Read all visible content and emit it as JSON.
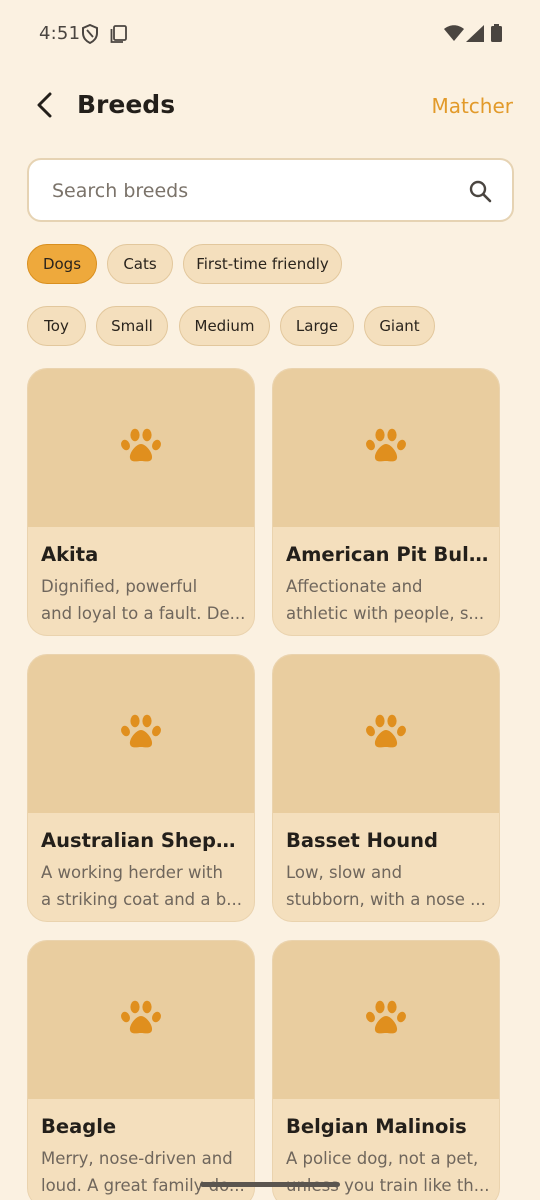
{
  "status_bar": {
    "time": "4:51",
    "icons": [
      "shield-icon",
      "screenshot-icon",
      "wifi-icon",
      "signal-icon",
      "battery-icon"
    ]
  },
  "app_bar": {
    "back_icon": "arrow-back-icon",
    "title": "Breeds",
    "action_label": "Matcher"
  },
  "search": {
    "placeholder": "Search breeds",
    "icon": "search-icon"
  },
  "filters": {
    "species": [
      {
        "label": "Dogs",
        "selected": true
      },
      {
        "label": "Cats",
        "selected": false
      },
      {
        "label": "First-time friendly",
        "selected": false
      }
    ],
    "sizes": [
      {
        "label": "Toy",
        "selected": false
      },
      {
        "label": "Small",
        "selected": false
      },
      {
        "label": "Medium",
        "selected": false
      },
      {
        "label": "Large",
        "selected": false
      },
      {
        "label": "Giant",
        "selected": false
      }
    ]
  },
  "breeds": [
    {
      "name": "Akita",
      "desc_line1": "Dignified, powerful",
      "desc_line2": "and loyal to a fault. De..."
    },
    {
      "name": "American Pit Bull T...",
      "desc_line1": "Affectionate and",
      "desc_line2": "athletic with people, s..."
    },
    {
      "name": "Australian Shepherd",
      "desc_line1": "A working herder with",
      "desc_line2": "a striking coat and a b..."
    },
    {
      "name": "Basset Hound",
      "desc_line1": "Low, slow and",
      "desc_line2": "stubborn, with a nose ..."
    },
    {
      "name": "Beagle",
      "desc_line1": "Merry, nose-driven and",
      "desc_line2": "loud. A great family do..."
    },
    {
      "name": "Belgian Malinois",
      "desc_line1": "A police dog, not a pet,",
      "desc_line2": "unless you train like th..."
    }
  ],
  "colors": {
    "background": "#fbf1e1",
    "accent": "#e29a2a",
    "chip_selected": "#eea93c",
    "chip": "#f4dfbd",
    "card_image": "#e9cd9f",
    "paw": "#e08f1e"
  }
}
